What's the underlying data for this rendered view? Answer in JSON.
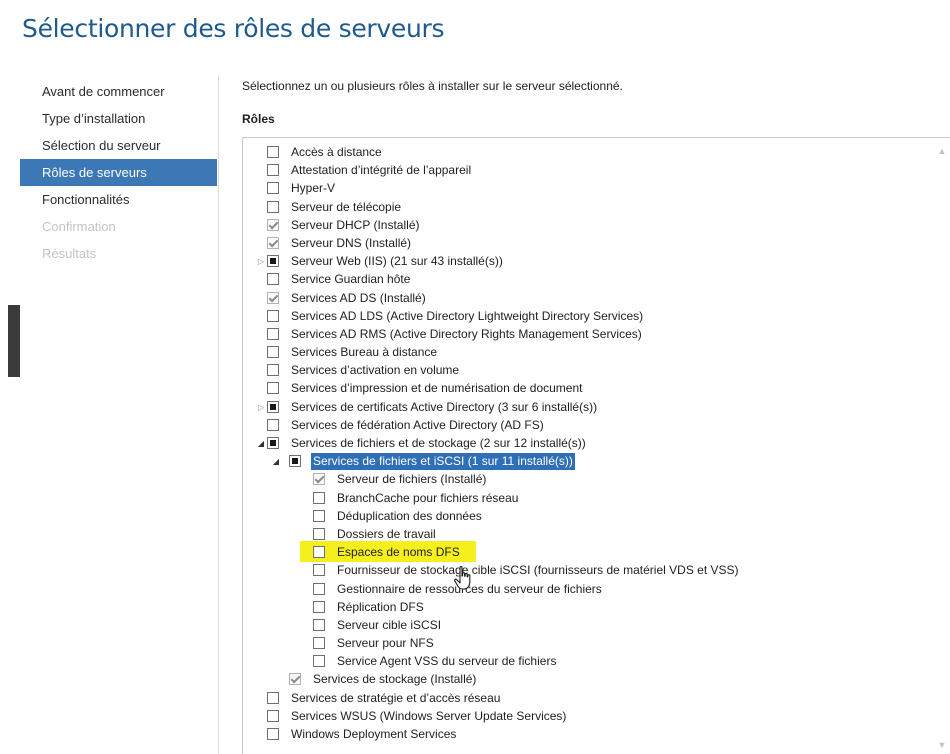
{
  "page": {
    "title": "Sélectionner des rôles de serveurs",
    "instruction": "Sélectionnez un ou plusieurs rôles à installer sur le serveur sélectionné.",
    "roles_label": "Rôles"
  },
  "nav": {
    "items": [
      {
        "label": "Avant de commencer",
        "state": "normal"
      },
      {
        "label": "Type d’installation",
        "state": "normal"
      },
      {
        "label": "Sélection du serveur",
        "state": "normal"
      },
      {
        "label": "Rôles de serveurs",
        "state": "active"
      },
      {
        "label": "Fonctionnalités",
        "state": "normal"
      },
      {
        "label": "Confirmation",
        "state": "disabled"
      },
      {
        "label": "Résultats",
        "state": "disabled"
      }
    ]
  },
  "roles": [
    {
      "label": "Accès à distance",
      "level": 0,
      "check": "unchecked",
      "expander": "none"
    },
    {
      "label": "Attestation d’intégrité de l’appareil",
      "level": 0,
      "check": "unchecked",
      "expander": "none"
    },
    {
      "label": "Hyper-V",
      "level": 0,
      "check": "unchecked",
      "expander": "none"
    },
    {
      "label": "Serveur de télécopie",
      "level": 0,
      "check": "unchecked",
      "expander": "none"
    },
    {
      "label": "Serveur DHCP (Installé)",
      "level": 0,
      "check": "checked",
      "expander": "none"
    },
    {
      "label": "Serveur DNS (Installé)",
      "level": 0,
      "check": "checked",
      "expander": "none"
    },
    {
      "label": "Serveur Web (IIS) (21 sur 43 installé(s))",
      "level": 0,
      "check": "partial",
      "expander": "collapsed"
    },
    {
      "label": "Service Guardian hôte",
      "level": 0,
      "check": "unchecked",
      "expander": "none"
    },
    {
      "label": "Services AD DS (Installé)",
      "level": 0,
      "check": "checked",
      "expander": "none"
    },
    {
      "label": "Services AD LDS (Active Directory Lightweight Directory Services)",
      "level": 0,
      "check": "unchecked",
      "expander": "none"
    },
    {
      "label": "Services AD RMS (Active Directory Rights Management Services)",
      "level": 0,
      "check": "unchecked",
      "expander": "none"
    },
    {
      "label": "Services Bureau à distance",
      "level": 0,
      "check": "unchecked",
      "expander": "none"
    },
    {
      "label": "Services d’activation en volume",
      "level": 0,
      "check": "unchecked",
      "expander": "none"
    },
    {
      "label": "Services d’impression et de numérisation de document",
      "level": 0,
      "check": "unchecked",
      "expander": "none"
    },
    {
      "label": "Services de certificats Active Directory (3 sur 6 installé(s))",
      "level": 0,
      "check": "partial",
      "expander": "collapsed"
    },
    {
      "label": "Services de fédération Active Directory (AD FS)",
      "level": 0,
      "check": "unchecked",
      "expander": "none"
    },
    {
      "label": "Services de fichiers et de stockage (2 sur 12 installé(s))",
      "level": 0,
      "check": "partial",
      "expander": "expanded"
    },
    {
      "label": "Services de fichiers et iSCSI (1 sur 11 installé(s))",
      "level": 1,
      "check": "partial",
      "expander": "expanded",
      "selected": true
    },
    {
      "label": "Serveur de fichiers (Installé)",
      "level": 2,
      "check": "checked",
      "expander": "none"
    },
    {
      "label": "BranchCache pour fichiers réseau",
      "level": 2,
      "check": "unchecked",
      "expander": "none"
    },
    {
      "label": "Déduplication des données",
      "level": 2,
      "check": "unchecked",
      "expander": "none"
    },
    {
      "label": "Dossiers de travail",
      "level": 2,
      "check": "unchecked",
      "expander": "none"
    },
    {
      "label": "Espaces de noms DFS",
      "level": 2,
      "check": "unchecked",
      "expander": "none",
      "highlight": true
    },
    {
      "label": "Fournisseur de stockage cible iSCSI (fournisseurs de matériel VDS et VSS)",
      "level": 2,
      "check": "unchecked",
      "expander": "none"
    },
    {
      "label": "Gestionnaire de ressources du serveur de fichiers",
      "level": 2,
      "check": "unchecked",
      "expander": "none"
    },
    {
      "label": "Réplication DFS",
      "level": 2,
      "check": "unchecked",
      "expander": "none"
    },
    {
      "label": "Serveur cible iSCSI",
      "level": 2,
      "check": "unchecked",
      "expander": "none"
    },
    {
      "label": "Serveur pour NFS",
      "level": 2,
      "check": "unchecked",
      "expander": "none"
    },
    {
      "label": "Service Agent VSS du serveur de fichiers",
      "level": 2,
      "check": "unchecked",
      "expander": "none"
    },
    {
      "label": "Services de stockage (Installé)",
      "level": 1,
      "check": "checked",
      "expander": "none"
    },
    {
      "label": "Services de stratégie et d’accès réseau",
      "level": 0,
      "check": "unchecked",
      "expander": "none"
    },
    {
      "label": "Services WSUS (Windows Server Update Services)",
      "level": 0,
      "check": "unchecked",
      "expander": "none"
    },
    {
      "label": "Windows Deployment Services",
      "level": 0,
      "check": "unchecked",
      "expander": "none"
    }
  ],
  "icons": {
    "expander_collapsed": "triangle-right-icon",
    "expander_expanded": "triangle-down-icon",
    "scroll_up": "chevron-up-icon",
    "scroll_down": "chevron-down-icon",
    "cursor": "hand-pointer-icon"
  },
  "colors": {
    "title": "#1f5a8e",
    "nav_active": "#3c78b5",
    "selection": "#2f6fb7",
    "highlight": "#f6ef1e"
  }
}
